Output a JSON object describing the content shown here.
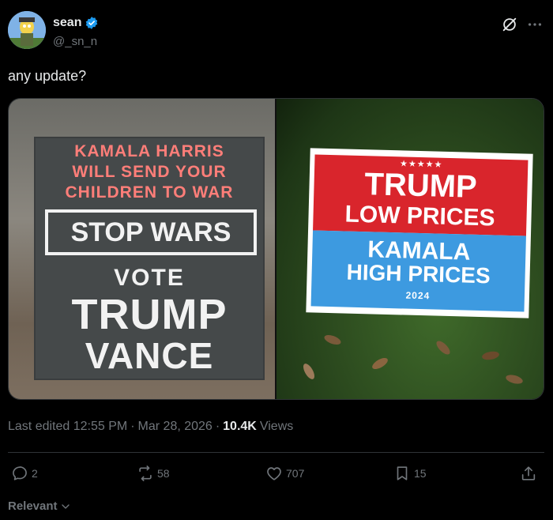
{
  "post": {
    "author_name": "sean",
    "author_handle": "@_sn_n",
    "text": "any update?"
  },
  "media": {
    "left_sign": {
      "line1": "KAMALA HARRIS",
      "line2": "WILL SEND YOUR",
      "line3": "CHILDREN TO WAR",
      "boxed": "STOP WARS",
      "vote": "VOTE",
      "trump": "TRUMP",
      "vance": "VANCE"
    },
    "right_sign": {
      "stars": "★★★★★",
      "trump": "TRUMP",
      "low": "LOW PRICES",
      "kamala": "KAMALA",
      "high": "HIGH PRICES",
      "year": "2024"
    }
  },
  "meta": {
    "edited": "Last edited 12:55 PM",
    "sep1": "·",
    "date": "Mar 28, 2026",
    "sep2": "·",
    "views_count": "10.4K",
    "views_label": "Views"
  },
  "actions": {
    "replies": "2",
    "reposts": "58",
    "likes": "707",
    "bookmarks": "15"
  },
  "sort": {
    "label": "Relevant"
  },
  "colors": {
    "background": "#000000",
    "text": "#e7e9ea",
    "muted": "#71767b",
    "verified": "#1d9bf0"
  }
}
